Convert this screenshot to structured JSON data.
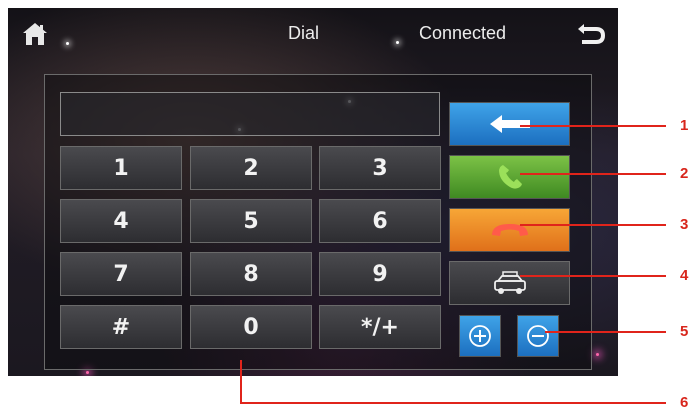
{
  "header": {
    "title": "Dial",
    "status": "Connected",
    "home_icon": "home-icon",
    "back_icon": "return-arrow-icon"
  },
  "dialer": {
    "display_value": "",
    "keys": [
      "1",
      "2",
      "3",
      "4",
      "5",
      "6",
      "7",
      "8",
      "9",
      "#",
      "0",
      "*/+"
    ]
  },
  "side_buttons": {
    "backspace_icon": "left-arrow-icon",
    "call_icon": "phone-handset-icon",
    "hangup_icon": "hang-up-icon",
    "car_icon": "car-icon",
    "volume_up_icon": "plus-circle-icon",
    "volume_down_icon": "minus-circle-icon"
  },
  "callouts": [
    "1",
    "2",
    "3",
    "4",
    "5",
    "6"
  ],
  "colors": {
    "accent_blue": "#2a8ad8",
    "call_green": "#5aa833",
    "hangup_orange": "#f08a24",
    "callout_red": "#e0241b"
  }
}
